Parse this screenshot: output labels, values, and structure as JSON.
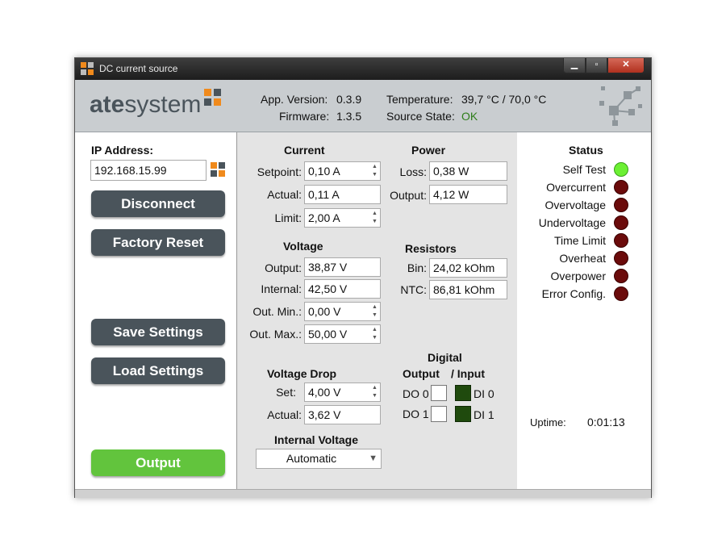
{
  "window": {
    "title": "DC current source",
    "min_icon": "minimize-icon",
    "max_icon": "maximize-icon",
    "close_icon": "close-icon"
  },
  "header": {
    "logo_text_ate": "ate",
    "logo_text_system": "system",
    "app_version_label": "App. Version:",
    "app_version": "0.3.9",
    "firmware_label": "Firmware:",
    "firmware": "1.3.5",
    "temperature_label": "Temperature:",
    "temperature": "39,7 °C / 70,0 °C",
    "source_state_label": "Source State:",
    "source_state": "OK",
    "ok_color": "#2e7d1a"
  },
  "left": {
    "ip_label": "IP Address:",
    "ip_value": "192.168.15.99",
    "disconnect": "Disconnect",
    "factory_reset": "Factory Reset",
    "save_settings": "Save Settings",
    "load_settings": "Load Settings",
    "output": "Output"
  },
  "current": {
    "heading": "Current",
    "setpoint_label": "Setpoint:",
    "setpoint": "0,10 A",
    "actual_label": "Actual:",
    "actual": "0,11 A",
    "limit_label": "Limit:",
    "limit": "2,00 A"
  },
  "power": {
    "heading": "Power",
    "loss_label": "Loss:",
    "loss": "0,38 W",
    "output_label": "Output:",
    "output": "4,12 W"
  },
  "voltage": {
    "heading": "Voltage",
    "output_label": "Output:",
    "output": "38,87 V",
    "internal_label": "Internal:",
    "internal": "42,50 V",
    "out_min_label": "Out. Min.:",
    "out_min": "0,00 V",
    "out_max_label": "Out. Max.:",
    "out_max": "50,00 V"
  },
  "resistors": {
    "heading": "Resistors",
    "bin_label": "Bin:",
    "bin": "24,02 kOhm",
    "ntc_label": "NTC:",
    "ntc": "86,81 kOhm"
  },
  "voltage_drop": {
    "heading": "Voltage Drop",
    "set_label": "Set:",
    "set": "4,00 V",
    "actual_label": "Actual:",
    "actual": "3,62 V"
  },
  "internal_voltage": {
    "heading": "Internal Voltage",
    "selected": "Automatic"
  },
  "digital": {
    "heading": "Digital",
    "subheading_output": "Output",
    "subheading_input": "/ Input",
    "do0": "DO 0",
    "do1": "DO 1",
    "di0": "DI 0",
    "di1": "DI 1"
  },
  "status": {
    "heading": "Status",
    "items": [
      {
        "label": "Self Test",
        "state": "ok"
      },
      {
        "label": "Overcurrent",
        "state": "off"
      },
      {
        "label": "Overvoltage",
        "state": "off"
      },
      {
        "label": "Undervoltage",
        "state": "off"
      },
      {
        "label": "Time Limit",
        "state": "off"
      },
      {
        "label": "Overheat",
        "state": "off"
      },
      {
        "label": "Overpower",
        "state": "off"
      },
      {
        "label": "Error Config.",
        "state": "off"
      }
    ],
    "uptime_label": "Uptime:",
    "uptime": "0:01:13"
  }
}
